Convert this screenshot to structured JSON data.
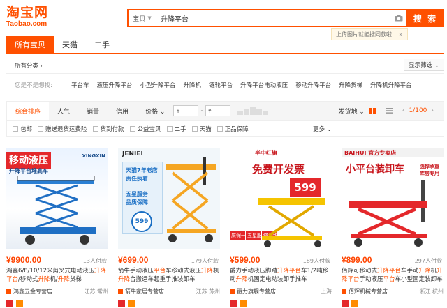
{
  "logo": {
    "cn": "淘宝网",
    "en": "Taobao.com"
  },
  "search": {
    "scope": "宝贝",
    "query": "升降平台",
    "button": "搜 索"
  },
  "tip": {
    "text": "上传图片就能搜同款啦!",
    "close": "×"
  },
  "tabs": [
    "所有宝贝",
    "天猫",
    "二手"
  ],
  "category": {
    "label": "所有分类 ›",
    "display": "显示筛选 ⌄"
  },
  "suggestions": {
    "label": "您是不是想找:",
    "items": [
      "平台车",
      "液压升降平台",
      "小型升降平台",
      "升降机",
      "链轮平台",
      "升降平台电动液压",
      "移动升降平台",
      "升降货梯",
      "升降机升降平台"
    ]
  },
  "sort": {
    "items": [
      "综合排序",
      "人气",
      "销量",
      "信用",
      "价格 ⌄"
    ],
    "price_from": "¥",
    "price_to": "¥",
    "ship_from": "发货地 ⌄",
    "page": "1/100"
  },
  "filters": {
    "items": [
      "包邮",
      "赠送退货运费险",
      "货到付款",
      "公益宝贝",
      "二手",
      "天猫",
      "正品保障"
    ],
    "more": "更多 ⌄"
  },
  "products": [
    {
      "img_lines": [
        "移动液压",
        "升降平台堆高车"
      ],
      "img_badge": "XINGXIN",
      "price": "¥9900.00",
      "deals": "13人付款",
      "title_parts": [
        "鸿鑫6/8/10/12米剪叉式电动液压",
        "升降",
        "平台",
        "/移动式",
        "升降",
        "机/",
        "升降",
        "货梯"
      ],
      "shop": "鸿鑫五金专营店",
      "location": "江苏 常州"
    },
    {
      "img_lines": [
        "天猫7年老店",
        "责任执着",
        "五星服务",
        "品质保障"
      ],
      "img_badge": "JENIEI",
      "img_price": "599",
      "price": "¥699.00",
      "deals": "179人付款",
      "title_parts": [
        "箭牛手动液压",
        "平台",
        "车移动式液压",
        "升降",
        "机",
        "升降",
        "台搬运车起重手推装卸车"
      ],
      "shop": "箭牛家居专营店",
      "location": "江苏 苏州"
    },
    {
      "img_lines": [
        "免费开发票",
        "599",
        "质保一年",
        "五星服务",
        "终身维护"
      ],
      "img_badge": "半中红旗",
      "price": "¥599.00",
      "deals": "189人付款",
      "title_parts": [
        "爵力手动液压脚踏",
        "升降平台",
        "车1/2吨移动",
        "升降",
        "机固定电动装卸手推车"
      ],
      "shop": "爵力旗舰专营店",
      "location": "上海"
    },
    {
      "img_lines": [
        "小平台装卸车",
        "强悍承重",
        "库房专用"
      ],
      "img_badge": "BAIHUI 官方专卖店",
      "price": "¥899.00",
      "deals": "297人付款",
      "title_parts": [
        "佰辉可移动式",
        "升降平台",
        "车手动",
        "升降",
        "机",
        "升降",
        "平台",
        "手动液压",
        "平台",
        "车小型固定装卸车"
      ],
      "shop": "佰辉机械专营店",
      "location": "浙江 杭州"
    }
  ],
  "colors": {
    "accent": "#ff5000",
    "price": "#ff4400"
  }
}
